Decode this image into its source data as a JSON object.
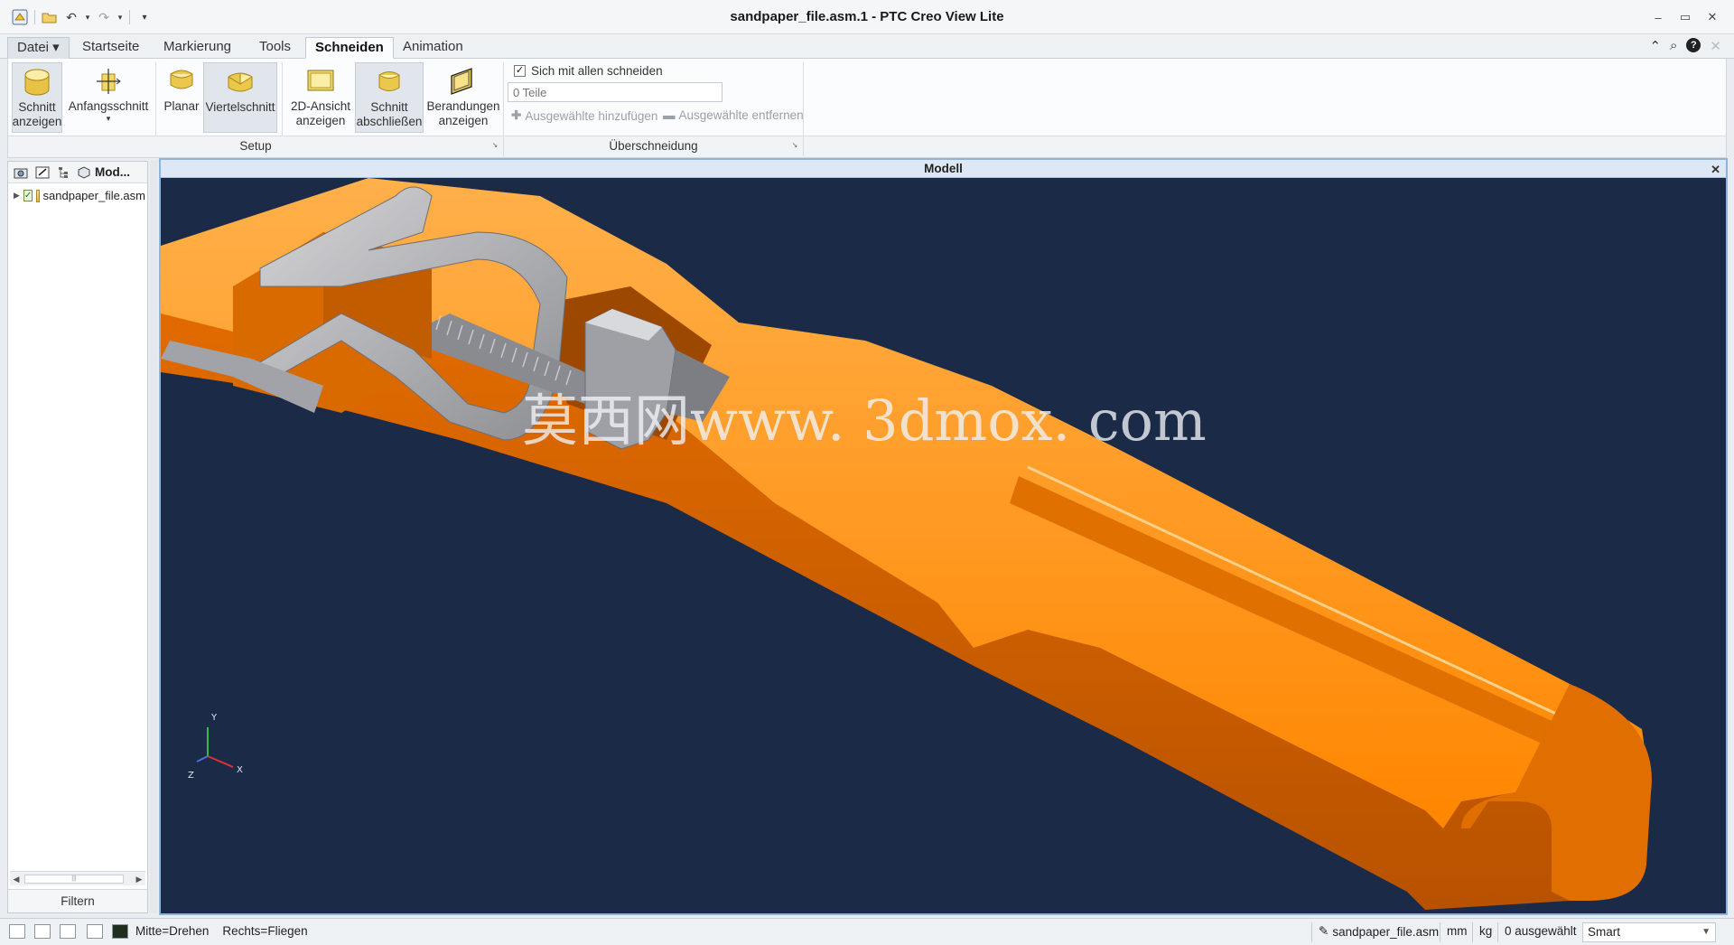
{
  "window": {
    "title": "sandpaper_file.asm.1 - PTC Creo View Lite"
  },
  "quick_access": {
    "dropdown_arrow": "▾",
    "customize_arrow": "▾"
  },
  "tabs": [
    {
      "label": "Datei ▾"
    },
    {
      "label": "Startseite"
    },
    {
      "label": "Markierung"
    },
    {
      "label": "Tools"
    },
    {
      "label": "Schneiden"
    },
    {
      "label": "Animation"
    }
  ],
  "ribbon": {
    "buttons": [
      {
        "line1": "Schnitt",
        "line2": "anzeigen",
        "icon": "show-cut-icon"
      },
      {
        "line1": "Anfangsschnitt",
        "line2": "▾",
        "icon": "start-cut-icon"
      },
      {
        "line1": "Planar",
        "line2": "",
        "icon": "planar-cut-icon"
      },
      {
        "line1": "Viertelschnitt",
        "line2": "",
        "icon": "quarter-cut-icon"
      },
      {
        "line1": "2D-Ansicht",
        "line2": "anzeigen",
        "icon": "2d-view-icon"
      },
      {
        "line1": "Schnitt",
        "line2": "abschließen",
        "icon": "cap-cut-icon"
      },
      {
        "line1": "Berandungen",
        "line2": "anzeigen",
        "icon": "show-edges-icon"
      }
    ],
    "groups": {
      "setup": "Setup",
      "intersection": "Überschneidung"
    },
    "intersect_all_label": "Sich mit allen schneiden",
    "intersect_all_checked": true,
    "parts_placeholder": "0 Teile",
    "add_selected": "Ausgewählte hinzufügen",
    "remove_selected": "Ausgewählte entfernen"
  },
  "left_panel": {
    "tab_label": "Mod...",
    "tree_item": "sandpaper_file.asm",
    "filter_label": "Filtern"
  },
  "viewport": {
    "title": "Modell",
    "watermark": "莫西网www. 3dmox. com",
    "axis_labels": {
      "x": "X",
      "y": "Y",
      "z": "Z"
    },
    "colors": {
      "background": "#1b2b47",
      "part_orange": "#ff8c0a",
      "part_grey": "#b9b9bc"
    }
  },
  "status_bar": {
    "mouse_hint": "Mitte=Drehen    Rechts=Fliegen",
    "file": "sandpaper_file.asm",
    "unit_length": "mm",
    "unit_mass": "kg",
    "selection": "0 ausgewählt",
    "filter_mode": "Smart"
  }
}
